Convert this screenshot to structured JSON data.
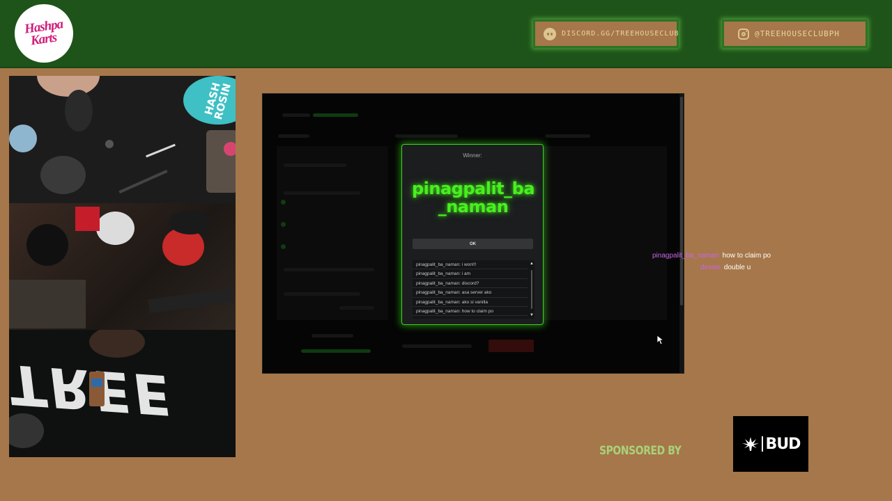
{
  "header": {
    "logo_text": [
      "Hashpa",
      "Karts"
    ],
    "discord_label": "DISCORD.GG/TREEHOUSECLUB",
    "instagram_label": "@TREEHOUSECLUBPH"
  },
  "colors": {
    "banner": "#1e5419",
    "background": "#a6774a",
    "winner_green": "#48f01f",
    "chat_username": "#c866e8",
    "sponsor_text": "#a8d27a"
  },
  "cameras": {
    "sticker_lines": [
      "HASH",
      "ROSIN"
    ]
  },
  "winner_modal": {
    "label": "Winner:",
    "name": "pinagpalit_ba_naman",
    "ok_label": "OK",
    "chat_log": [
      "pinagpalit_ba_naman: i won!!!",
      "pinagpalit_ba_naman: i am",
      "pinagpalit_ba_naman: discord?",
      "pinagpalit_ba_naman: asa server ako",
      "pinagpalit_ba_naman: ako si vanilla",
      "pinagpalit_ba_naman: how to claim po"
    ]
  },
  "stream_chat": [
    {
      "user": "pinagpalit_ba_naman",
      "message": "how to claim po"
    },
    {
      "user": "dessio",
      "message": "double u"
    }
  ],
  "sponsor": {
    "label": "SPONSORED BY",
    "brand": "BUD"
  }
}
